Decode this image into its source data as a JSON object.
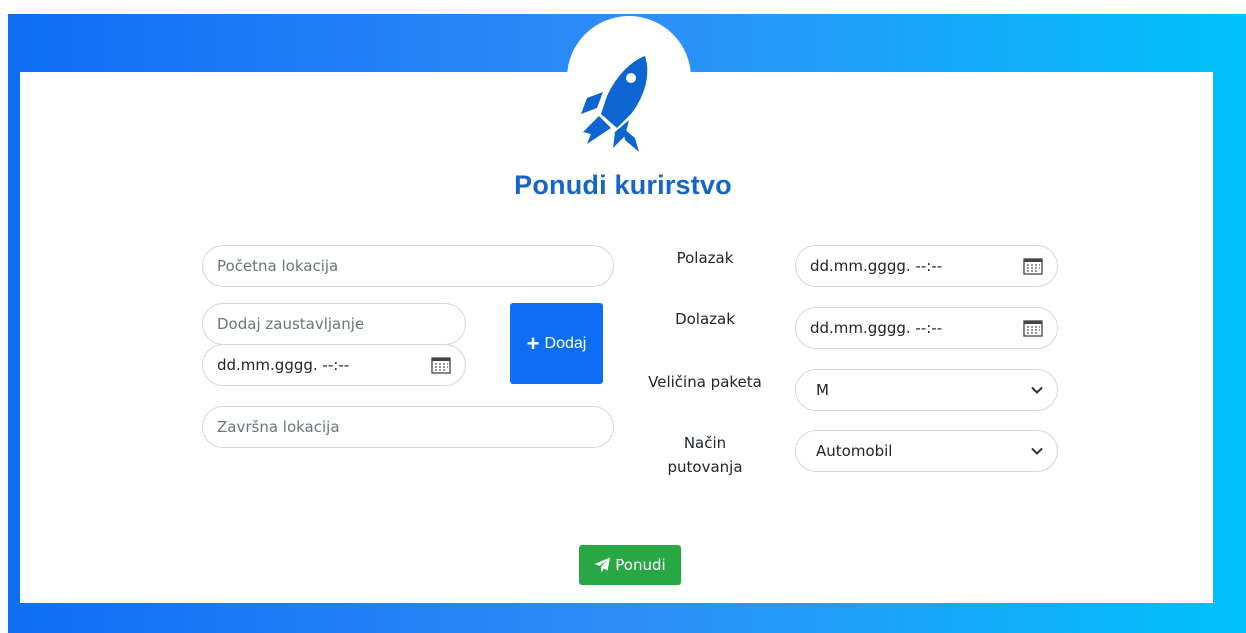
{
  "header": {
    "title": "Ponudi kurirstvo",
    "icon": "rocket-icon",
    "accent_color": "#1565c8"
  },
  "form": {
    "start_location": {
      "placeholder": "Početna lokacija"
    },
    "stop": {
      "placeholder": "Dodaj zaustavljanje",
      "datetime_placeholder": "dd.mm.gggg. --:--"
    },
    "add_button": {
      "label": "Dodaj",
      "icon": "plus-icon"
    },
    "end_location": {
      "placeholder": "Završna lokacija"
    },
    "departure": {
      "label": "Polazak",
      "placeholder": "dd.mm.gggg. --:--"
    },
    "arrival": {
      "label": "Dolazak",
      "placeholder": "dd.mm.gggg. --:--"
    },
    "package_size": {
      "label": "Veličina paketa",
      "selected": "M"
    },
    "travel_mode": {
      "label_line1": "Način",
      "label_line2": "putovanja",
      "selected": "Automobil"
    },
    "submit": {
      "label": "Ponudi",
      "icon": "paper-plane-icon",
      "color": "#28a745"
    }
  },
  "colors": {
    "primary": "#0d6ef5",
    "gradient_end": "#00c2fb"
  }
}
